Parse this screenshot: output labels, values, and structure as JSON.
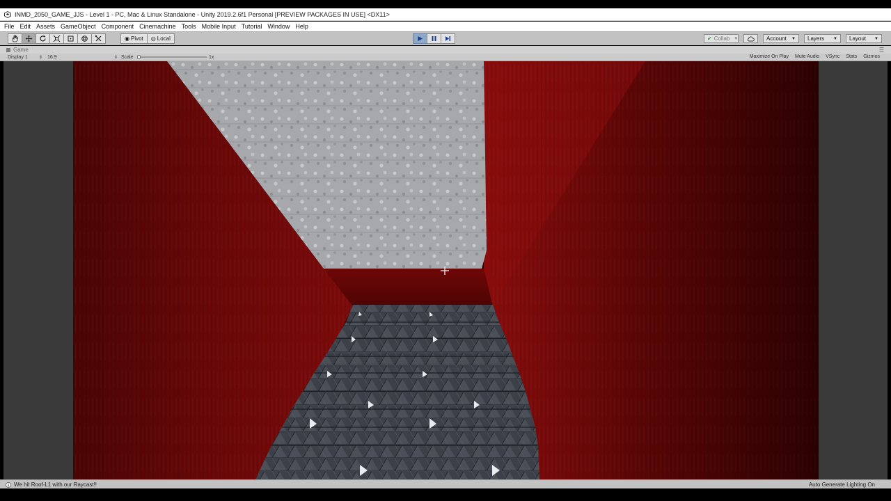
{
  "window": {
    "title": "INMD_2050_GAME_JJS - Level 1 - PC, Mac & Linux Standalone - Unity 2019.2.6f1 Personal [PREVIEW PACKAGES IN USE] <DX11>"
  },
  "menu": {
    "items": [
      "File",
      "Edit",
      "Assets",
      "GameObject",
      "Component",
      "Cinemachine",
      "Tools",
      "Mobile Input",
      "Tutorial",
      "Window",
      "Help"
    ]
  },
  "toolbar": {
    "tools": [
      "hand-icon",
      "move-icon",
      "rotate-icon",
      "scale-icon",
      "rect-icon",
      "transform-icon",
      "custom-tool-icon"
    ],
    "pivot_label": "Pivot",
    "local_label": "Local",
    "collab_label": "Collab",
    "account_label": "Account",
    "layers_label": "Layers",
    "layout_label": "Layout",
    "play_active": true
  },
  "game_view": {
    "tab_label": "Game",
    "display": "Display 1",
    "aspect": "16:9",
    "scale_label": "Scale",
    "scale_value": "1x",
    "options": [
      "Maximize On Play",
      "Mute Audio",
      "VSync",
      "Stats",
      "Gizmos"
    ]
  },
  "status": {
    "message": "We hit Roof-L1 with our Raycast!!",
    "right": "Auto Generate Lighting On"
  },
  "colors": {
    "wall_red": "#7a0a0a",
    "dark_red": "#3d0000",
    "ceiling_gray": "#a8aaac",
    "stairs_dark": "#3c4048",
    "play_blue": "#8fa8c8"
  }
}
